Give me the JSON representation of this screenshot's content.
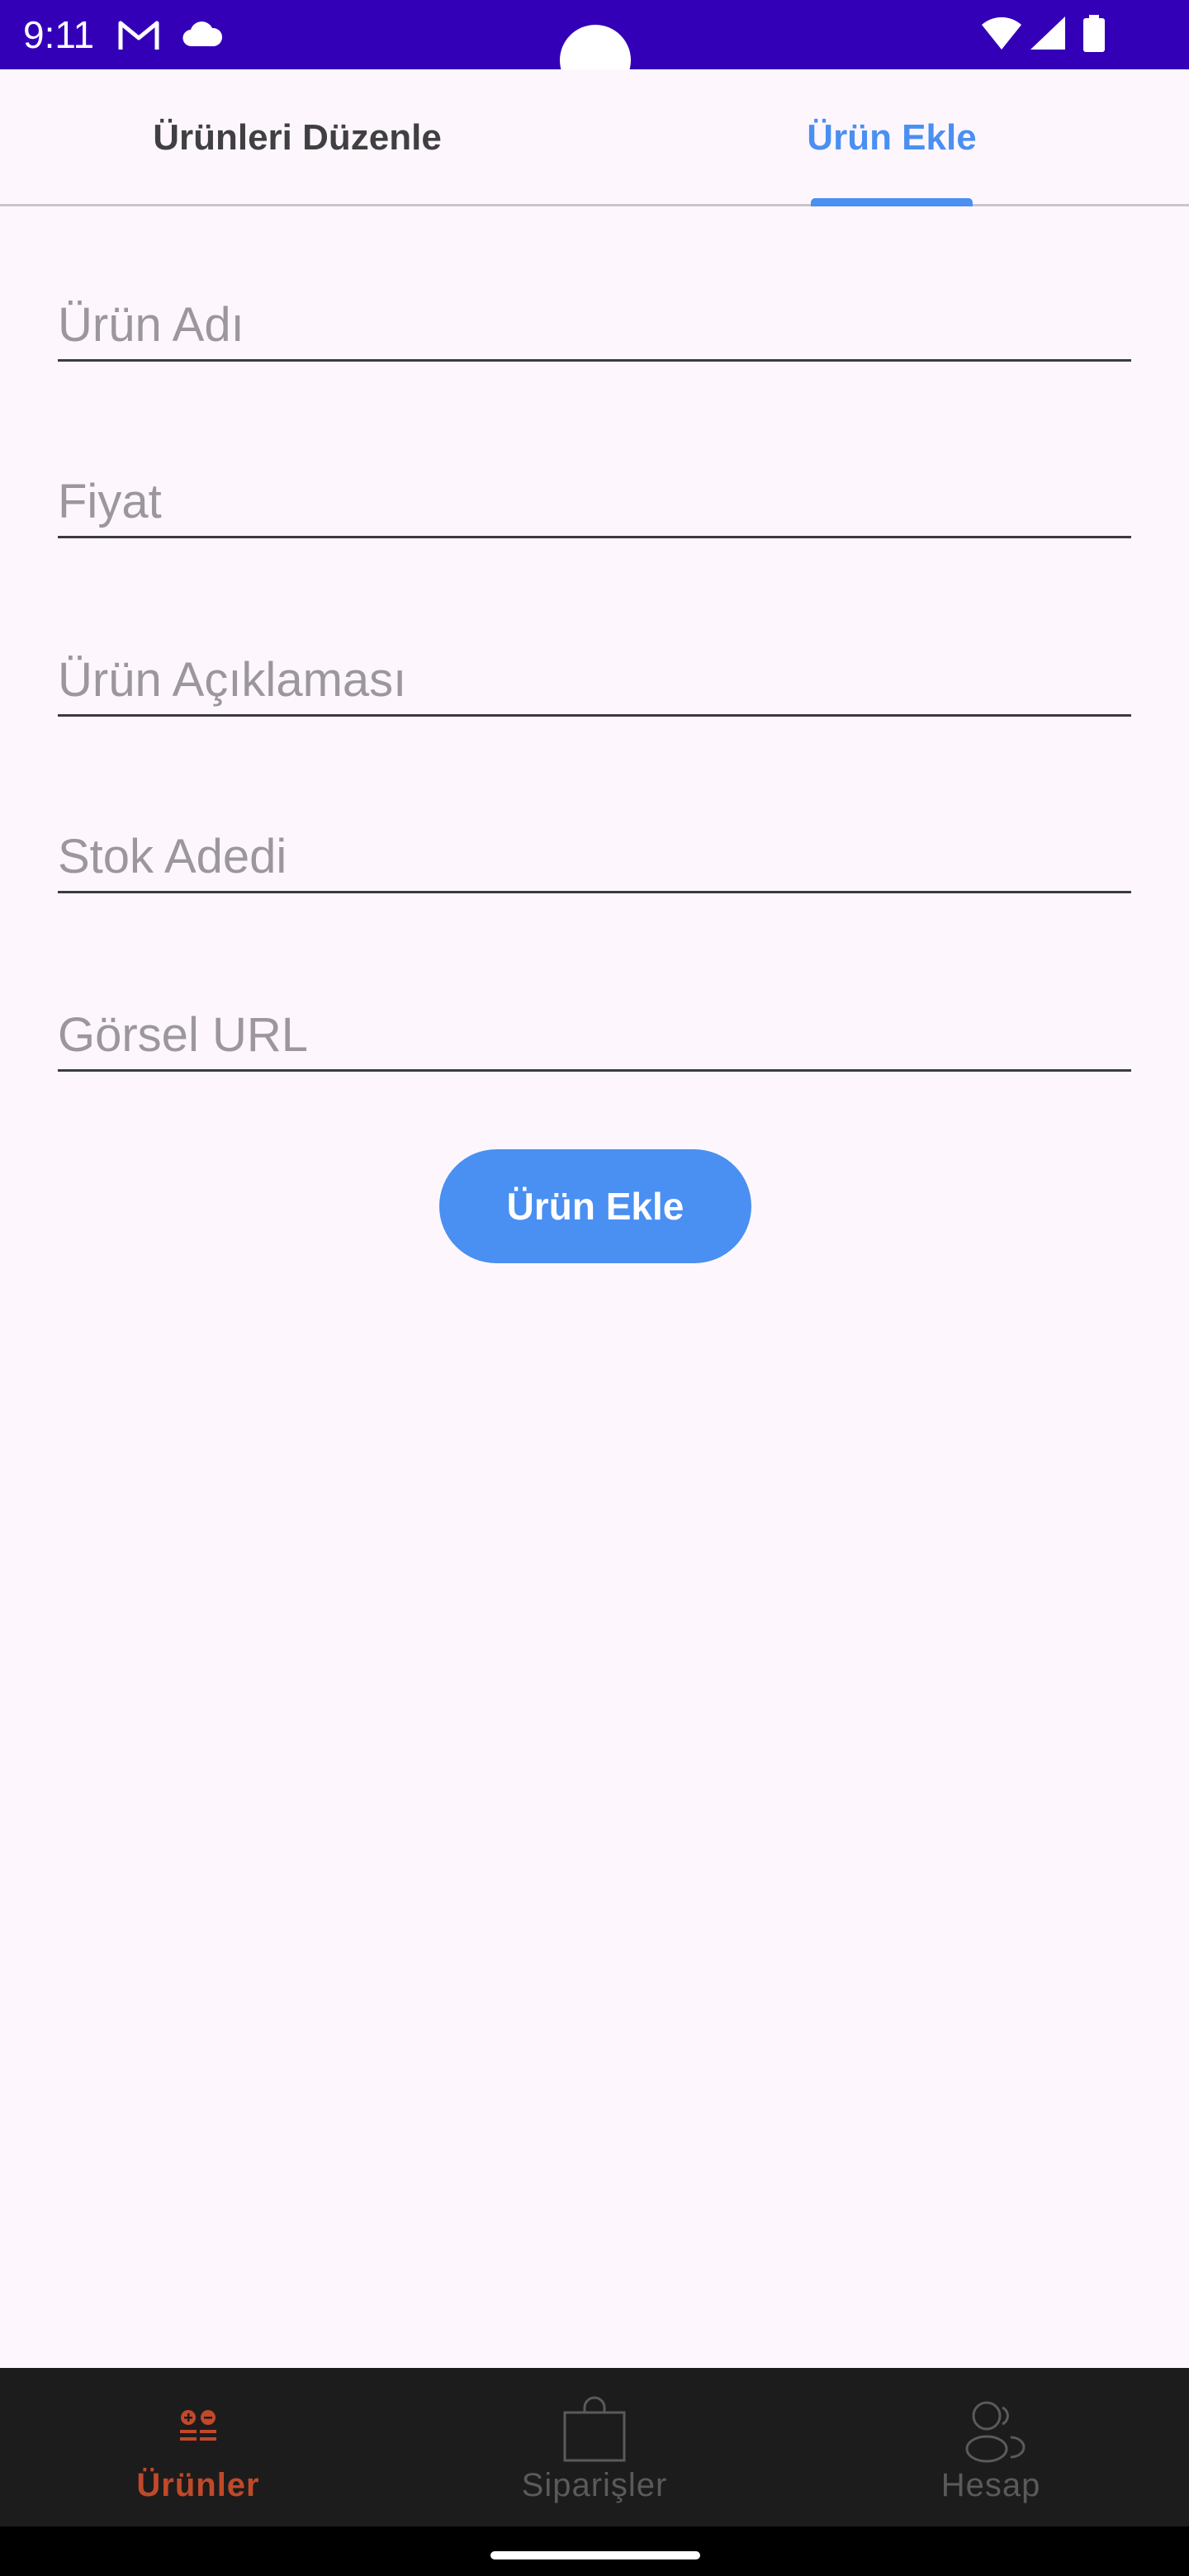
{
  "status_bar": {
    "time": "9:11",
    "icons": [
      "gmail-icon",
      "cloud-icon",
      "wifi-icon",
      "signal-icon",
      "battery-icon"
    ]
  },
  "tabs": [
    {
      "label": "Ürünleri Düzenle",
      "active": false
    },
    {
      "label": "Ürün Ekle",
      "active": true
    }
  ],
  "form": {
    "fields": [
      {
        "placeholder": "Ürün Adı",
        "value": ""
      },
      {
        "placeholder": "Fiyat",
        "value": ""
      },
      {
        "placeholder": "Ürün Açıklaması",
        "value": ""
      },
      {
        "placeholder": "Stok Adedi",
        "value": ""
      },
      {
        "placeholder": "Görsel URL",
        "value": ""
      }
    ],
    "submit_label": "Ürün Ekle"
  },
  "bottom_nav": {
    "items": [
      {
        "label": "Ürünler",
        "icon": "products-icon",
        "active": true
      },
      {
        "label": "Siparişler",
        "icon": "shopping-bag-icon",
        "active": false
      },
      {
        "label": "Hesap",
        "icon": "account-icon",
        "active": false
      }
    ]
  },
  "colors": {
    "status_bar": "#3300b8",
    "accent": "#4a8ff2",
    "nav_active": "#c0492a",
    "nav_background": "#1d1c1c",
    "page_background": "#fdf7fd"
  }
}
